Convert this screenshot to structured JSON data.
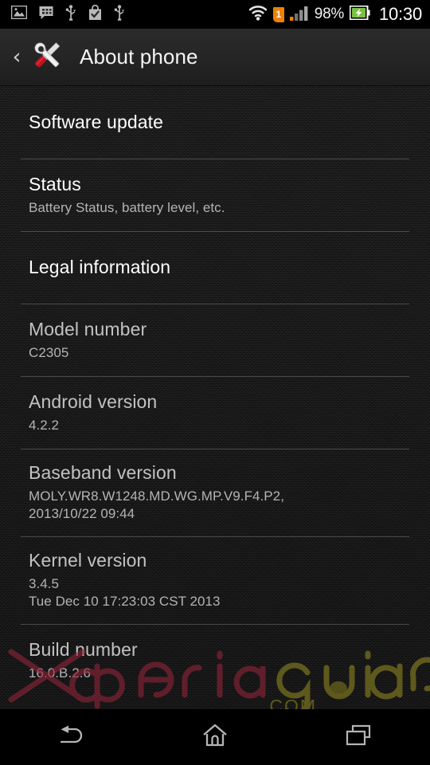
{
  "status_bar": {
    "left_icons": [
      {
        "name": "screenshot-image-icon",
        "label": "Screenshot captured"
      },
      {
        "name": "bbm-message-icon",
        "label": "BBM message"
      },
      {
        "name": "usb-connection-icon",
        "label": "USB connected"
      },
      {
        "name": "play-store-bag-check-icon",
        "label": "App installed"
      },
      {
        "name": "usb-debugging-icon",
        "label": "USB debugging"
      }
    ],
    "wifi_icon": "wifi-icon",
    "sim_badge": "1",
    "sim_badge_color": "#f08000",
    "signal_icon": "cellular-signal-icon",
    "signal_bars_active": 1,
    "signal_bars_total": 4,
    "battery_percent": "98%",
    "battery_icon": "battery-charging-icon",
    "battery_color": "#7bc043",
    "clock": "10:30"
  },
  "action_bar": {
    "back_icon": "back-chevron-icon",
    "app_icon": "settings-tools-icon",
    "title": "About phone"
  },
  "settings_list": [
    {
      "name": "software-update",
      "title": "Software update",
      "subtitle": null,
      "type": "action"
    },
    {
      "name": "status",
      "title": "Status",
      "subtitle": [
        "Battery Status, battery level, etc."
      ],
      "type": "action"
    },
    {
      "name": "legal-information",
      "title": "Legal information",
      "subtitle": null,
      "type": "action"
    },
    {
      "name": "model-number",
      "title": "Model number",
      "subtitle": [
        "C2305"
      ],
      "type": "info"
    },
    {
      "name": "android-version",
      "title": "Android version",
      "subtitle": [
        "4.2.2"
      ],
      "type": "info"
    },
    {
      "name": "baseband-version",
      "title": "Baseband version",
      "subtitle": [
        "MOLY.WR8.W1248.MD.WG.MP.V9.F4.P2,",
        "2013/10/22 09:44"
      ],
      "type": "info"
    },
    {
      "name": "kernel-version",
      "title": "Kernel version",
      "subtitle": [
        "3.4.5",
        "Tue Dec 10 17:23:03 CST 2013"
      ],
      "type": "info"
    },
    {
      "name": "build-number",
      "title": "Build number",
      "subtitle": [
        "16.0.B.2.6"
      ],
      "type": "info"
    }
  ],
  "watermark": {
    "part1": "xperia",
    "part2": "Guide",
    "part3": ".COM",
    "part1_color": "#8e2438",
    "part2_color": "#8a8220"
  },
  "nav_bar": {
    "back": "back-arrow-icon",
    "home": "home-icon",
    "recents": "recent-apps-icon"
  }
}
